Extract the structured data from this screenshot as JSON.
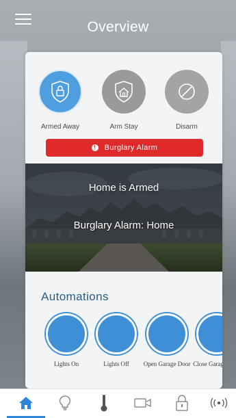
{
  "header": {
    "title": "Overview",
    "menu_icon": "hamburger-menu-icon"
  },
  "security_modes": [
    {
      "label": "Armed Away",
      "icon": "shield-lock-icon",
      "state": "active"
    },
    {
      "label": "Arm Stay",
      "icon": "house-shield-icon",
      "state": "inactive"
    },
    {
      "label": "Disarm",
      "icon": "disarm-slash-icon",
      "state": "inactive"
    }
  ],
  "alarm": {
    "label": "Burglary Alarm",
    "icon": "alert-icon",
    "color": "#e02a2a"
  },
  "status": {
    "armed_text": "Home is Armed",
    "alarm_text": "Burglary Alarm: Home"
  },
  "automations": {
    "title": "Automations",
    "items": [
      {
        "label": "Lights On"
      },
      {
        "label": "Lights Off"
      },
      {
        "label": "Open Garage Door"
      },
      {
        "label": "Close Garage Door"
      }
    ]
  },
  "nav": {
    "items": [
      {
        "name": "home",
        "icon": "home-icon",
        "active": true
      },
      {
        "name": "lights",
        "icon": "lightbulb-icon",
        "active": false
      },
      {
        "name": "thermostat",
        "icon": "thermometer-icon",
        "active": false
      },
      {
        "name": "cameras",
        "icon": "video-camera-icon",
        "active": false
      },
      {
        "name": "locks",
        "icon": "lock-icon",
        "active": false
      },
      {
        "name": "sensors",
        "icon": "wireless-signal-icon",
        "active": false
      }
    ]
  },
  "colors": {
    "accent": "#2f86d8",
    "active_mode": "#4f9fe0",
    "automation_circle": "#3f8fd6",
    "automations_title": "#2a5d86"
  }
}
